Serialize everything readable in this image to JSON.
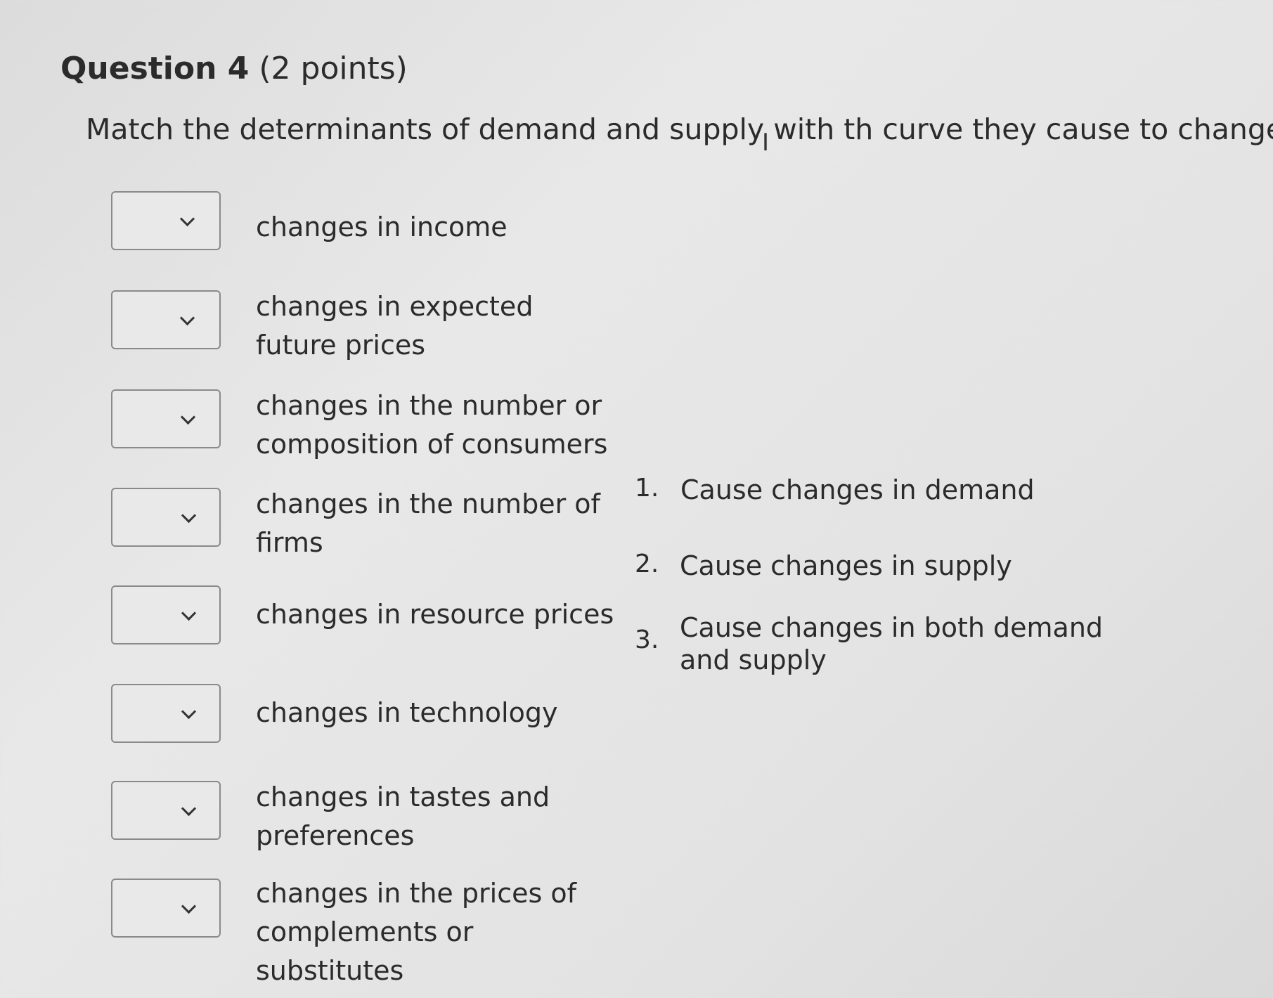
{
  "question": {
    "title": "Question 4",
    "points": " (2 points)",
    "prompt_before_cursor": "Match the determinants of demand and supply with th",
    "prompt_after_cursor": " curve they cause to change."
  },
  "rows": [
    {
      "label": "changes in income",
      "selected": ""
    },
    {
      "label": "changes in expected future prices",
      "selected": ""
    },
    {
      "label": "changes in the number or composition of consumers",
      "selected": ""
    },
    {
      "label": "changes in the number of firms",
      "selected": ""
    },
    {
      "label": "changes in resource prices",
      "selected": ""
    },
    {
      "label": "changes in technology",
      "selected": ""
    },
    {
      "label": "changes in tastes and preferences",
      "selected": ""
    },
    {
      "label": "changes in the prices of complements or substitutes",
      "selected": ""
    }
  ],
  "options": [
    {
      "number": "1.",
      "text": "Cause changes in demand"
    },
    {
      "number": "2.",
      "text": "Cause changes in supply"
    },
    {
      "number": "3.",
      "text": "Cause changes in both demand and supply"
    }
  ],
  "icons": {
    "dropdown": "chevron-down-icon",
    "cursor": "text-cursor-icon"
  }
}
